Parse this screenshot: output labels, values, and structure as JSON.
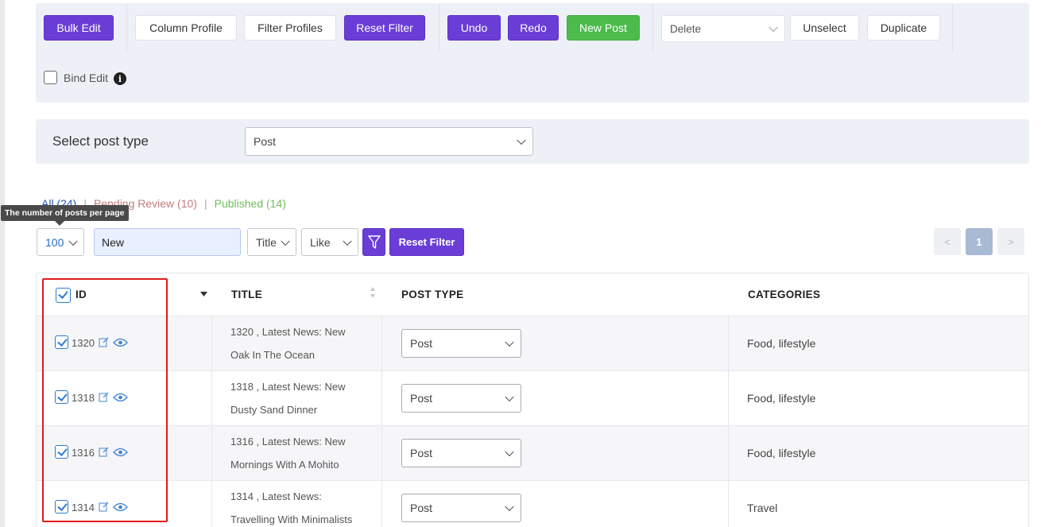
{
  "toolbar": {
    "bulk_edit": "Bulk Edit",
    "column_profile": "Column Profile",
    "filter_profiles": "Filter Profiles",
    "reset_filter": "Reset Filter",
    "undo": "Undo",
    "redo": "Redo",
    "new_post": "New Post",
    "action_select": "Delete",
    "unselect": "Unselect",
    "duplicate": "Duplicate",
    "bind_edit_label": "Bind Edit",
    "bind_edit_checked": false
  },
  "post_type_filter": {
    "label": "Select post type",
    "value": "Post"
  },
  "status_links": {
    "all": "All (24)",
    "pending": "Pending Review (10)",
    "published": "Published (14)",
    "separator": "|"
  },
  "tooltip": "The number of posts per page",
  "filter_bar": {
    "per_page": "100",
    "search_value": "New",
    "field": "Title",
    "operator": "Like",
    "reset_filter": "Reset Filter"
  },
  "pagination": {
    "prev": "<",
    "current": "1",
    "next": ">"
  },
  "table": {
    "columns": [
      "ID",
      "TITLE",
      "POST TYPE",
      "CATEGORIES"
    ],
    "rows": [
      {
        "id": "1320",
        "title_line1": "1320 , Latest News: New",
        "title_line2": "Oak In The Ocean",
        "post_type": "Post",
        "categories": "Food, lifestyle"
      },
      {
        "id": "1318",
        "title_line1": "1318 , Latest News: New",
        "title_line2": "Dusty Sand Dinner",
        "post_type": "Post",
        "categories": "Food, lifestyle"
      },
      {
        "id": "1316",
        "title_line1": "1316 , Latest News: New",
        "title_line2": "Mornings With A Mohito",
        "post_type": "Post",
        "categories": "Food, lifestyle"
      },
      {
        "id": "1314",
        "title_line1": "1314 , Latest News:",
        "title_line2": "Travelling With Minimalists",
        "post_type": "Post",
        "categories": "Travel"
      }
    ]
  },
  "colors": {
    "primary_purple": "#6a3ed6",
    "success_green": "#4cbb4c",
    "highlight_frame": "#e01b1b",
    "checkbox_blue": "#2a7bd1"
  }
}
